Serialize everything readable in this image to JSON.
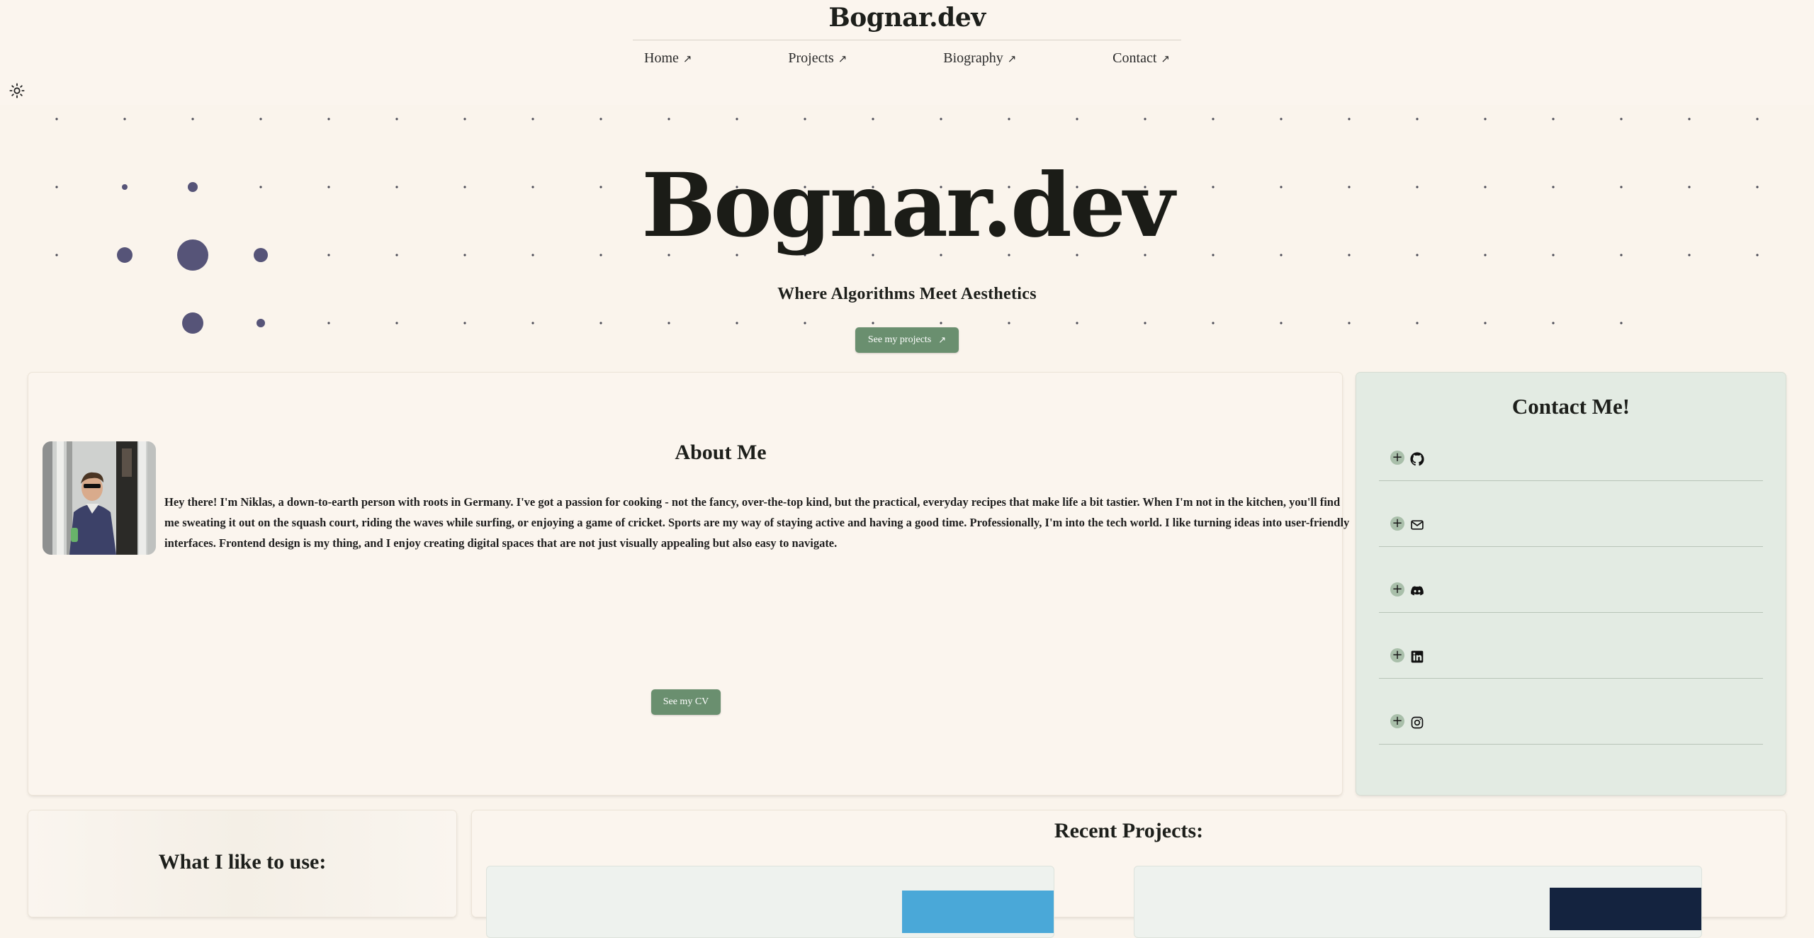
{
  "header": {
    "brand": "Bognar.dev",
    "nav": [
      {
        "label": "Home"
      },
      {
        "label": "Projects"
      },
      {
        "label": "Biography"
      },
      {
        "label": "Contact"
      }
    ],
    "arrow_glyph": "↗",
    "theme_icon": "sun-icon"
  },
  "hero": {
    "title": "Bognar.dev",
    "subtitle": "Where Algorithms Meet Aesthetics",
    "cta_label": "See my projects",
    "dot_color": "#565478"
  },
  "about": {
    "title": "About Me",
    "text": "Hey there! I'm Niklas, a down-to-earth person with roots in Germany. I've got a passion for cooking - not the fancy, over-the-top kind, but the practical, everyday recipes that make life a bit tastier. When I'm not in the kitchen, you'll find me sweating it out on the squash court, riding the waves while surfing, or enjoying a game of cricket. Sports are my way of staying active and having a good time. Professionally, I'm into the tech world. I like turning ideas into user-friendly interfaces. Frontend design is my thing, and I enjoy creating digital spaces that are not just visually appealing but also easy to navigate.",
    "cv_label": "See my CV"
  },
  "contact": {
    "title": "Contact Me!",
    "items": [
      {
        "icon": "github-icon"
      },
      {
        "icon": "mail-icon"
      },
      {
        "icon": "discord-icon"
      },
      {
        "icon": "linkedin-icon"
      },
      {
        "icon": "instagram-icon"
      }
    ]
  },
  "tools": {
    "title": "What I like to use:"
  },
  "projects": {
    "title": "Recent Projects:"
  },
  "colors": {
    "background": "#faf4ec",
    "accent_green": "#6a8f6f",
    "contact_bg": "#e3ebe3"
  }
}
